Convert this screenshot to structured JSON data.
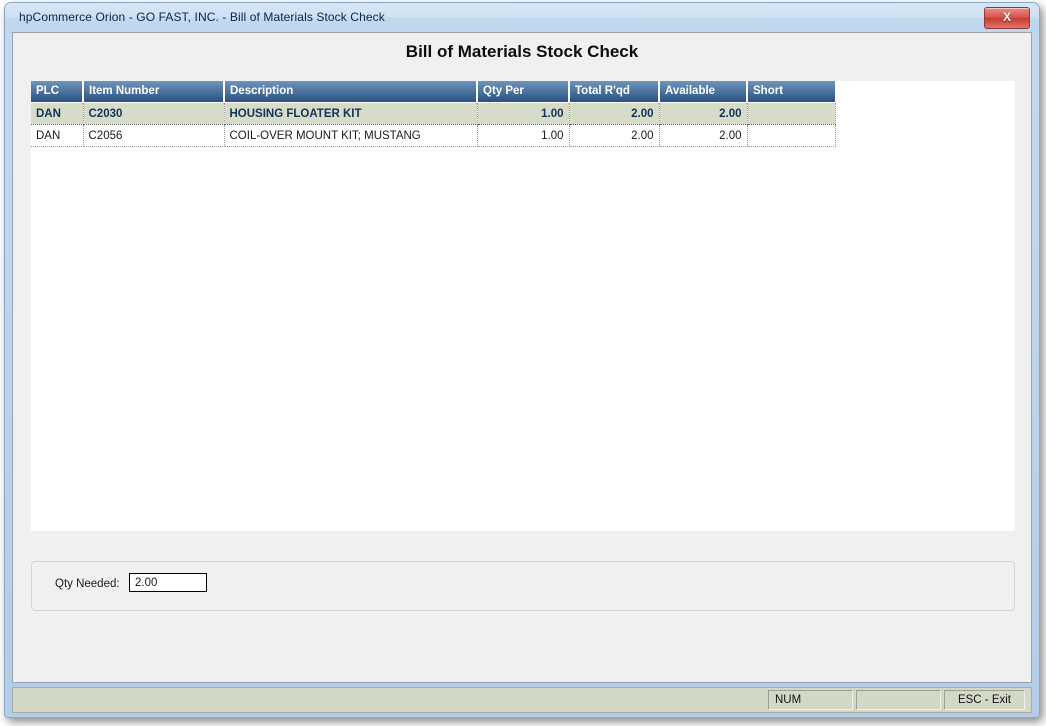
{
  "window": {
    "title": "hpCommerce Orion - GO FAST, INC. - Bill of Materials Stock Check",
    "close_glyph": "X",
    "close_label": "Close"
  },
  "page": {
    "heading": "Bill of Materials Stock Check"
  },
  "grid": {
    "columns": [
      {
        "key": "plc",
        "label": "PLC"
      },
      {
        "key": "item",
        "label": "Item Number"
      },
      {
        "key": "desc",
        "label": "Description"
      },
      {
        "key": "qty_per",
        "label": "Qty Per"
      },
      {
        "key": "total_rqd",
        "label": "Total R'qd"
      },
      {
        "key": "available",
        "label": "Available"
      },
      {
        "key": "short",
        "label": "Short"
      }
    ],
    "rows": [
      {
        "selected": true,
        "plc": "DAN",
        "item": "C2030",
        "desc": "HOUSING FLOATER KIT",
        "qty_per": "1.00",
        "total_rqd": "2.00",
        "available": "2.00",
        "short": ""
      },
      {
        "selected": false,
        "plc": "DAN",
        "item": "C2056",
        "desc": "COIL-OVER MOUNT KIT; MUSTANG",
        "qty_per": "1.00",
        "total_rqd": "2.00",
        "available": "2.00",
        "short": ""
      }
    ]
  },
  "qty_group": {
    "label": "Qty Needed:",
    "value": "2.00",
    "placeholder": ""
  },
  "status_bar": {
    "num_indicator": "NUM",
    "blank_panel": "",
    "exit_hint": "ESC - Exit"
  },
  "colors": {
    "header_gradient_top": "#6e94bb",
    "header_gradient_bottom": "#2c4f7d",
    "selected_row_bg": "#d6dcc7",
    "selected_row_text": "#13335c",
    "frame_blue": "#bed5ec",
    "status_bar_bg": "#d4d9c7",
    "close_button_red": "#c43c34",
    "client_bg": "#f0f0f0",
    "grid_bg": "#ffffff"
  }
}
